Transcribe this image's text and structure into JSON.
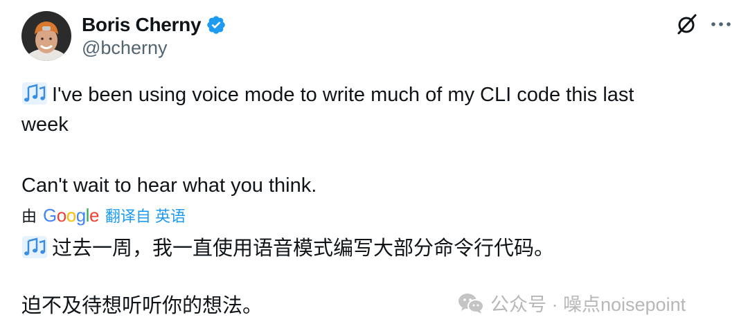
{
  "author": {
    "display_name": "Boris Cherny",
    "handle": "@bcherny",
    "verified": true
  },
  "icons": {
    "avatar": "avatar",
    "verified": "verified-badge-icon",
    "grok": "grok-icon",
    "more": "more-icon",
    "note": "musical-notes-icon",
    "watermark": "wechat-icon"
  },
  "colors": {
    "text": "#0f1419",
    "secondary_text": "#536471",
    "link": "#1d9bf0",
    "verified": "#1d9bf0"
  },
  "tweet": {
    "line1": "I've been using voice mode to write much of my CLI code this last",
    "line2": "week",
    "line3": "Can't wait to hear what you think."
  },
  "translation": {
    "by_label": "由",
    "provider": "Google",
    "translated_from": "翻译自 英语",
    "line1": "过去一周，我一直使用语音模式编写大部分命令行代码。",
    "line2": "迫不及待想听听你的想法。"
  },
  "watermark": {
    "text": "公众号 · 噪点noisepoint"
  }
}
